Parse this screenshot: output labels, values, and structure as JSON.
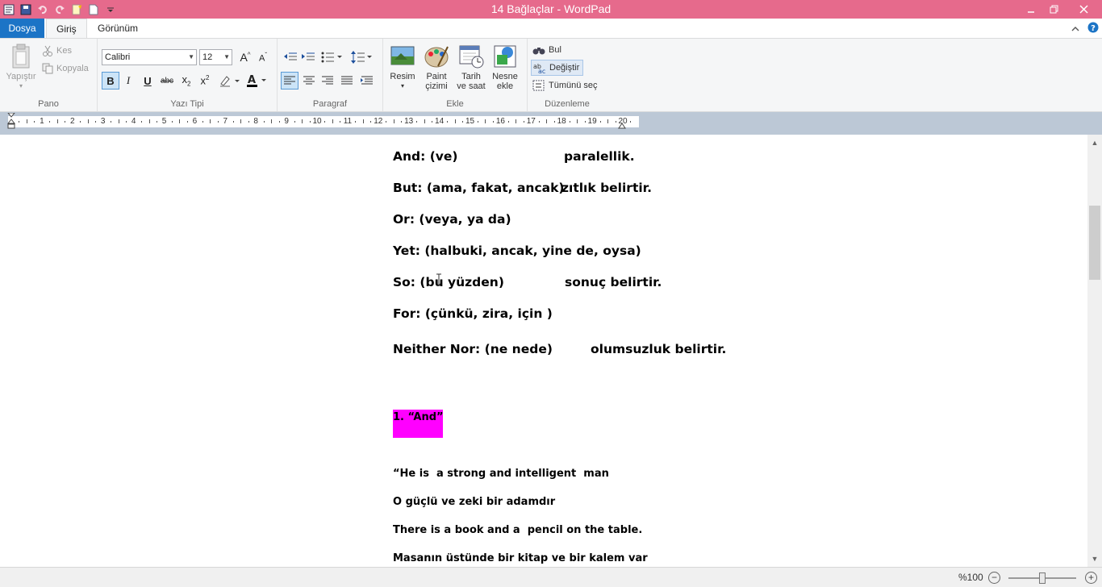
{
  "window": {
    "title": "14 Bağlaçlar - WordPad"
  },
  "tabs": {
    "file": "Dosya",
    "home": "Giriş",
    "view": "Görünüm"
  },
  "ribbon": {
    "pano": {
      "label": "Pano",
      "paste": "Yapıştır",
      "cut": "Kes",
      "copy": "Kopyala"
    },
    "font": {
      "label": "Yazı Tipi",
      "family": "Calibri",
      "size": "12"
    },
    "paragraph": {
      "label": "Paragraf"
    },
    "insert": {
      "label": "Ekle",
      "picture_l1": "Resim",
      "paint_l1": "Paint",
      "paint_l2": "çizimi",
      "datetime_l1": "Tarih",
      "datetime_l2": "ve saat",
      "object_l1": "Nesne",
      "object_l2": "ekle"
    },
    "editing": {
      "label": "Düzenleme",
      "find": "Bul",
      "replace": "Değiştir",
      "select_all": "Tümünü seç"
    }
  },
  "ruler": {
    "numbers": [
      "1",
      "2",
      "3",
      "4",
      "5",
      "6",
      "7",
      "8",
      "9",
      "10",
      "11",
      "12",
      "13",
      "14",
      "15",
      "16",
      "17",
      "18",
      "19",
      "20"
    ]
  },
  "document": {
    "and_a": "And: (ve)",
    "and_b": "paralellik.",
    "but_a": "But: (ama, fakat, ancak)",
    "but_b": "zıtlık belirtir.",
    "or": "Or: (veya, ya da)",
    "yet": "Yet: (halbuki, ancak, yine de, oysa)",
    "so_a": "So: (bu yüzden)",
    "so_b": "sonuç belirtir.",
    "for": "For: (çünkü, zira, için )",
    "neither_a": "Neither Nor: (ne nede)",
    "neither_b": "olumsuzluk belirtir.",
    "heading": "1. “And”",
    "ex1": "“He is  a strong and intelligent  man",
    "ex1_tr": "O güçlü ve zeki bir adamdır",
    "ex2": "There is a book and a  pencil on the table.",
    "ex2_tr": "Masanın üstünde bir kitap ve bir kalem var"
  },
  "status": {
    "zoom": "%100"
  }
}
